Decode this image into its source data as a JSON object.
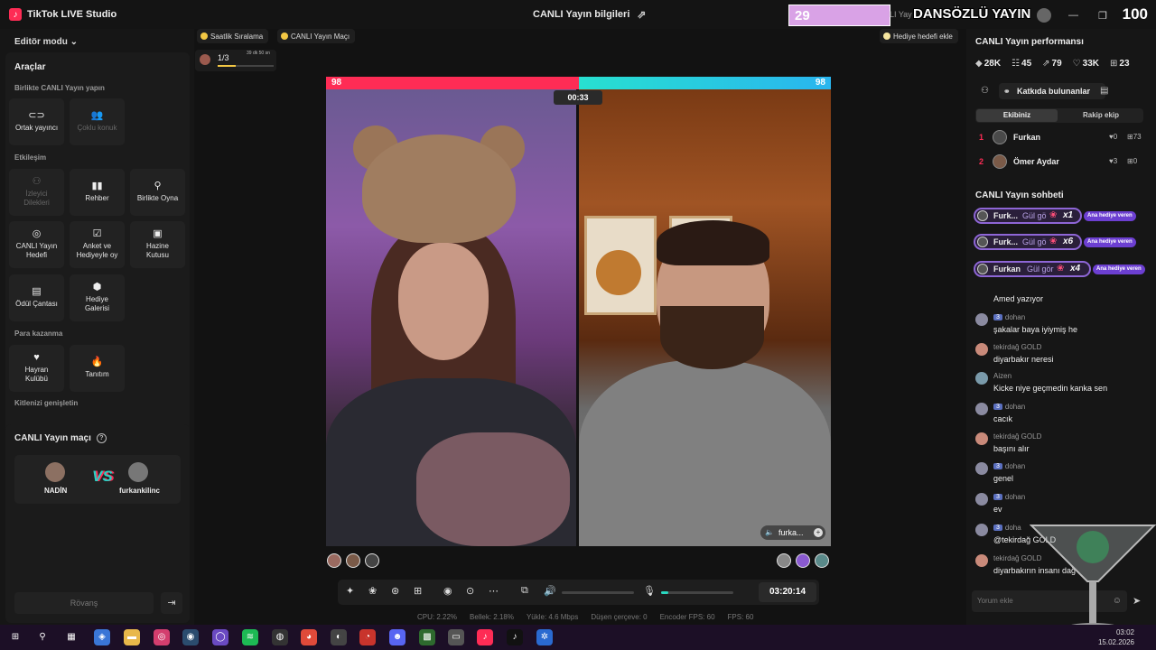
{
  "app": {
    "title": "TikTok LIVE Studio",
    "center_title": "CANLI Yayın bilgileri"
  },
  "overlay": {
    "left_value": "29",
    "title": "DANSÖZLÜ YAYIN",
    "faded_text": "LI Yay",
    "right_value": "100"
  },
  "left": {
    "editor_mode": "Editör modu",
    "tools_title": "Araçlar",
    "sec_together": "Birlikte CANLI Yayın yapın",
    "co_host": "Ortak yayıncı",
    "multi_guest": "Çoklu konuk",
    "sec_interaction": "Etkileşim",
    "viewer_requests_1": "İzleyici",
    "viewer_requests_2": "Dilekleri",
    "guide": "Rehber",
    "play_together": "Birlikte Oyna",
    "live_goal_1": "CANLI Yayın",
    "live_goal_2": "Hedefi",
    "poll_1": "Anket ve",
    "poll_2": "Hediyeyle oy",
    "treasure_1": "Hazine",
    "treasure_2": "Kutusu",
    "reward_bag": "Ödül Çantası",
    "gift_gallery_1": "Hediye",
    "gift_gallery_2": "Galerisi",
    "sec_monetize": "Para kazanma",
    "fan_club_1": "Hayran",
    "fan_club_2": "Kulübü",
    "promo": "Tanıtım",
    "sec_audience": "Kitlenizi genişletin",
    "match_title": "CANLI Yayın maçı",
    "player1": "NADİN",
    "player2": "furkankilinc",
    "vs": "VS",
    "rematch": "Rövanş"
  },
  "center": {
    "chip_hourly": "Saatlik Sıralama",
    "chip_match": "CANLI Yayın Maçı",
    "chip_gift_goal": "Hediye hedefi ekle",
    "goal_fraction": "1/3",
    "goal_fill": 0.33,
    "goal_time": "39 dk 50 sn",
    "score_left": "98",
    "score_right": "98",
    "battle_timer": "00:33",
    "right_cam_name": "furka...",
    "stream_time": "03:20:14",
    "volume_level": 0.0,
    "mic_level": 0.1
  },
  "stats": {
    "cpu": "CPU:  2.22%",
    "memory": "Bellek:  2.18%",
    "upload": "Yükle:  4.6 Mbps",
    "dropped": "Düşen çerçeve:  0",
    "encoder_fps": "Encoder FPS:  60",
    "fps": "FPS:  60"
  },
  "right": {
    "perf_title": "CANLI Yayın performansı",
    "coins": "28K",
    "viewers": "45",
    "shares": "79",
    "likes": "33K",
    "gifts": "23",
    "contributors": "Katkıda bulunanlar",
    "tab_team": "Ekibiniz",
    "tab_rival": "Rakip ekip",
    "ranks": [
      {
        "n": "1",
        "name": "Furkan",
        "hearts": "0",
        "gifts": "73"
      },
      {
        "n": "2",
        "name": "Ömer Aydar",
        "hearts": "3",
        "gifts": "0"
      }
    ],
    "chat_title": "CANLI Yayın sohbeti",
    "gifts_list": [
      {
        "name": "Furk...",
        "text": "Gül gö",
        "count": "x1",
        "badge": "Ana hediye veren"
      },
      {
        "name": "Furk...",
        "text": "Gül gö",
        "count": "x6",
        "badge": "Ana hediye veren"
      },
      {
        "name": "Furkan",
        "text": "Gül gör",
        "count": "x4",
        "badge": "Ana hediye veren"
      }
    ],
    "typing": "Amed yazıyor",
    "chat": [
      {
        "lvl": "3",
        "user": "dohan",
        "msg": "şakalar baya iyiymiş he"
      },
      {
        "lvl": "",
        "user": "tekirdağ GOLD",
        "msg": "diyarbakır neresi"
      },
      {
        "lvl": "",
        "user": "Aizen",
        "msg": "Kicke niye geçmedin kanka sen"
      },
      {
        "lvl": "3",
        "user": "dohan",
        "msg": "cacık"
      },
      {
        "lvl": "",
        "user": "tekirdağ GOLD",
        "msg": "başını alır"
      },
      {
        "lvl": "3",
        "user": "dohan",
        "msg": "genel"
      },
      {
        "lvl": "3",
        "user": "dohan",
        "msg": "ev"
      },
      {
        "lvl": "3",
        "user": "doha",
        "msg": "@tekirdağ GOLD"
      },
      {
        "lvl": "",
        "user": "tekirdağ GOLD",
        "msg": "diyarbakırın insanı dağ"
      }
    ],
    "comment_placeholder": "Yorum ekle"
  },
  "taskbar": {
    "time": "03:02",
    "date": "15.02.2026"
  },
  "colors": {
    "accent_pink": "#fe2c55",
    "accent_cyan": "#28e0d0",
    "gift_purple": "#8e66d6"
  }
}
